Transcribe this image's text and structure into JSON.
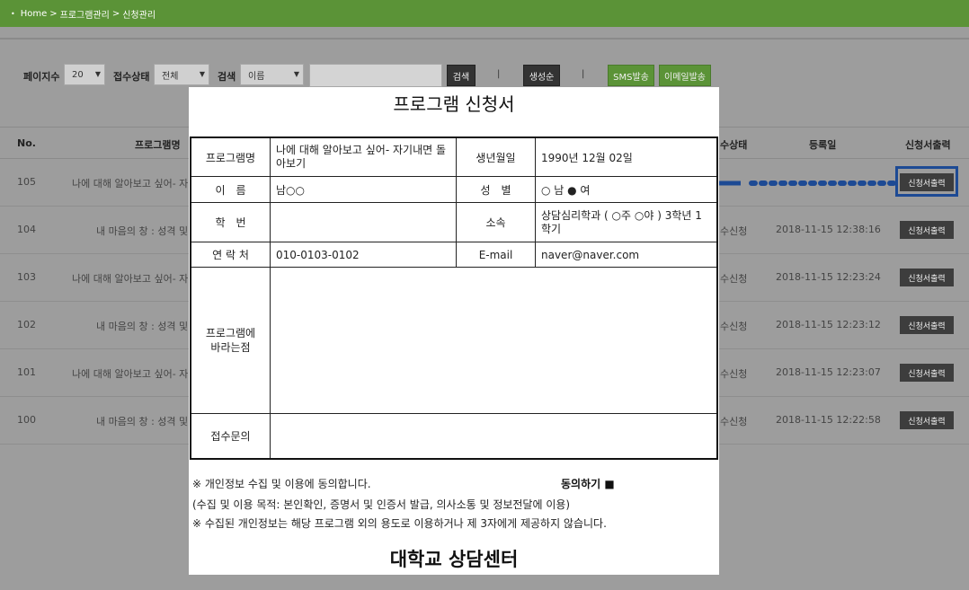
{
  "breadcrumb": {
    "items": [
      "Home",
      "프로그램관리",
      "신청관리"
    ],
    "separator": ">"
  },
  "filters": {
    "page_size_label": "페이지수",
    "page_size_value": "20",
    "status_label": "접수상태",
    "status_value": "전체",
    "search_label": "검색",
    "search_field_value": "이름",
    "search_input_value": "",
    "search_button": "검색",
    "sort_button": "생성순",
    "pipe": "|",
    "sms_button": "SMS발송",
    "email_button": "이메일발송"
  },
  "table": {
    "headers": {
      "no": "No.",
      "program": "프로그램명",
      "status": "수상태",
      "date": "등록일",
      "print": "신청서출력"
    },
    "rows": [
      {
        "no": "105",
        "program": "나에 대해 알아보고 싶어- 자기",
        "status": "",
        "date": "",
        "print": "신청서출력"
      },
      {
        "no": "104",
        "program": "내 마음의 창 : 성격 및 디",
        "status": "수신청",
        "date": "2018-11-15 12:38:16",
        "print": "신청서출력"
      },
      {
        "no": "103",
        "program": "나에 대해 알아보고 싶어- 자기",
        "status": "수신청",
        "date": "2018-11-15 12:23:24",
        "print": "신청서출력"
      },
      {
        "no": "102",
        "program": "내 마음의 창 : 성격 및 디",
        "status": "수신청",
        "date": "2018-11-15 12:23:12",
        "print": "신청서출력"
      },
      {
        "no": "101",
        "program": "나에 대해 알아보고 싶어- 자기",
        "status": "수신청",
        "date": "2018-11-15 12:23:07",
        "print": "신청서출력"
      },
      {
        "no": "100",
        "program": "내 마음의 창 : 성격 및 디",
        "status": "수신청",
        "date": "2018-11-15 12:22:58",
        "print": "신청서출력"
      }
    ]
  },
  "form": {
    "title": "프로그램 신청서",
    "program_label": "프로그램명",
    "program_value": "나에 대해 알아보고 싶어- 자기내면 돌아보기",
    "birth_label": "생년월일",
    "birth_value": "1990년 12월 02일",
    "name_label": "이　름",
    "name_value": "남○○",
    "gender_label": "성　별",
    "gender_value": "○ 남  ● 여",
    "student_id_label": "학　번",
    "student_id_value": "",
    "dept_label": "소속",
    "dept_value": "상담심리학과 ( ○주 ○야 ) 3학년 1학기",
    "phone_label": "연 락 처",
    "phone_value": "010-0103-0102",
    "email_label": "E-mail",
    "email_value": "naver@naver.com",
    "wishes_label": "프로그램에 바라는점",
    "wishes_value": "",
    "inquiry_label": "접수문의",
    "inquiry_value": "",
    "consent_line1": "※ 개인정보 수집 및 이용에 동의합니다.",
    "consent_check": "동의하기 ■",
    "consent_line2": "(수집 및 이용 목적: 본인확인, 증명서 및 인증서 발급, 의사소통 및 정보전달에 이용)",
    "consent_line3": "※ 수집된 개인정보는 해당 프로그램 외의 용도로 이용하거나 제 3자에게 제공하지 않습니다.",
    "footer": "대학교 상담센터"
  },
  "colors": {
    "topbar": "#5b9337",
    "highlight": "#1d4a94",
    "overlay": "#9d9d9d"
  }
}
